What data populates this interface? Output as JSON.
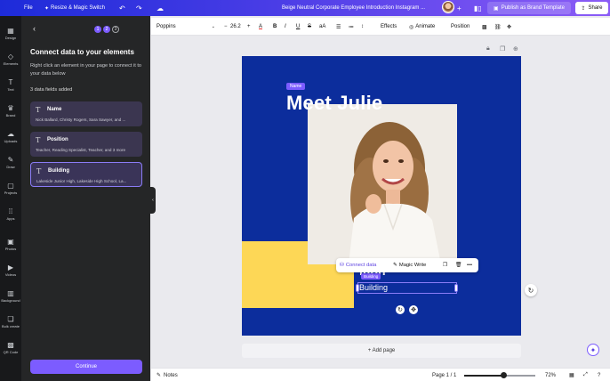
{
  "topbar": {
    "file": "File",
    "resize": "Resize & Magic Switch",
    "doc_title": "Beige Neutral Corporate Employee Introduction Instagram ...",
    "publish": "Publish as Brand Template",
    "share": "Share",
    "icons": [
      "undo-icon",
      "redo-icon",
      "cloud-icon",
      "plus-icon",
      "analytics-icon"
    ]
  },
  "rail": {
    "items": [
      {
        "label": "Design",
        "icon": "▦"
      },
      {
        "label": "Elements",
        "icon": "◇"
      },
      {
        "label": "Text",
        "icon": "T"
      },
      {
        "label": "Brand",
        "icon": "♛"
      },
      {
        "label": "Uploads",
        "icon": "☁"
      },
      {
        "label": "Draw",
        "icon": "✎"
      },
      {
        "label": "Projects",
        "icon": "▢"
      },
      {
        "label": "Apps",
        "icon": "⁞⁞"
      },
      {
        "label": "Photos",
        "icon": "▣"
      },
      {
        "label": "Videos",
        "icon": "▶"
      },
      {
        "label": "Background",
        "icon": "▥"
      },
      {
        "label": "Bulk create",
        "icon": "❏"
      },
      {
        "label": "QR Code",
        "icon": "▩"
      }
    ]
  },
  "panel": {
    "steps": [
      "1",
      "2",
      "3"
    ],
    "title": "Connect data to your elements",
    "description": "Right click an element in your page to connect it to your data below",
    "fields_count": "3 data fields added",
    "fields": [
      {
        "name": "Name",
        "values": "Nick Ballard, Christy Rogers, Sara Sawyer, and ..."
      },
      {
        "name": "Position",
        "values": "Teacher, Reading Specialist, Teacher, and 3 more"
      },
      {
        "name": "Building",
        "values": "Lakeside Junior High, Lakeside High School, La..."
      }
    ],
    "continue": "Continue"
  },
  "toolbar": {
    "font": "Poppins",
    "minus": "−",
    "size": "26.2",
    "plus": "+",
    "effects": "Effects",
    "animate": "Animate",
    "position": "Position"
  },
  "design": {
    "name_tag": "Name",
    "headline": "Meet Julie",
    "position_text": "ition",
    "building_tag": "Building",
    "building_value": "Building",
    "colors": {
      "background": "#0c2d9c",
      "block": "#fdd756",
      "accent": "#7c5cff"
    }
  },
  "context_menu": {
    "connect": "Connect data",
    "magic": "Magic Write"
  },
  "add_page": "+ Add page",
  "bottombar": {
    "notes": "Notes",
    "page": "Page 1 / 1",
    "zoom": "72%",
    "zoom_value": 0.55
  }
}
